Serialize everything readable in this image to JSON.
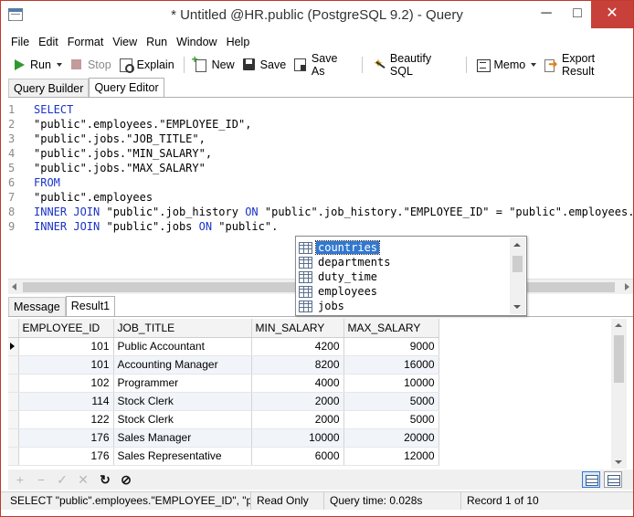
{
  "window": {
    "title": "* Untitled @HR.public (PostgreSQL 9.2) - Query",
    "min_glyph": "─",
    "max_glyph": "□",
    "close_glyph": "✕"
  },
  "menu": [
    "File",
    "Edit",
    "Format",
    "View",
    "Run",
    "Window",
    "Help"
  ],
  "toolbar": {
    "run": "Run",
    "stop": "Stop",
    "explain": "Explain",
    "new": "New",
    "save": "Save",
    "save_as": "Save As",
    "beautify": "Beautify SQL",
    "memo": "Memo",
    "export": "Export Result"
  },
  "editor_tabs": [
    "Query Builder",
    "Query Editor"
  ],
  "editor": {
    "lines": [
      {
        "n": "1",
        "kw": "SELECT",
        "text": ""
      },
      {
        "n": "2",
        "kw": "",
        "text": "\"public\".employees.\"EMPLOYEE_ID\","
      },
      {
        "n": "3",
        "kw": "",
        "text": "\"public\".jobs.\"JOB_TITLE\","
      },
      {
        "n": "4",
        "kw": "",
        "text": "\"public\".jobs.\"MIN_SALARY\","
      },
      {
        "n": "5",
        "kw": "",
        "text": "\"public\".jobs.\"MAX_SALARY\""
      },
      {
        "n": "6",
        "kw": "FROM",
        "text": ""
      },
      {
        "n": "7",
        "kw": "",
        "text": "\"public\".employees"
      },
      {
        "n": "8",
        "kw": "INNER JOIN",
        "text": " \"public\".job_history ",
        "kw2": "ON",
        "text2": " \"public\".job_history.\"EMPLOYEE_ID\" = \"public\".employees.\"EMPLOYEE_ID\""
      },
      {
        "n": "9",
        "kw": "INNER JOIN",
        "text": " \"public\".jobs ",
        "kw2": "ON",
        "text2": " \"public\"."
      }
    ]
  },
  "autocomplete": {
    "items": [
      "countries",
      "departments",
      "duty_time",
      "employees",
      "jobs"
    ],
    "selected": "countries"
  },
  "result_tabs": [
    "Message",
    "Result1"
  ],
  "grid": {
    "columns": [
      "EMPLOYEE_ID",
      "JOB_TITLE",
      "MIN_SALARY",
      "MAX_SALARY"
    ],
    "rows": [
      [
        "101",
        "Public Accountant",
        "4200",
        "9000"
      ],
      [
        "101",
        "Accounting Manager",
        "8200",
        "16000"
      ],
      [
        "102",
        "Programmer",
        "4000",
        "10000"
      ],
      [
        "114",
        "Stock Clerk",
        "2000",
        "5000"
      ],
      [
        "122",
        "Stock Clerk",
        "2000",
        "5000"
      ],
      [
        "176",
        "Sales Manager",
        "10000",
        "20000"
      ],
      [
        "176",
        "Sales Representative",
        "6000",
        "12000"
      ]
    ]
  },
  "navigator": {
    "add": "+",
    "delete": "−",
    "apply": "✓",
    "discard": "✕",
    "refresh": "↻",
    "stop": "⊘"
  },
  "status": {
    "sql": "SELECT \"public\".employees.\"EMPLOYEE_ID\", \"public\".jobs.\"JOB_TITLE\"",
    "mode": "Read Only",
    "query_time": "Query time: 0.028s",
    "record": "Record 1 of 10"
  }
}
